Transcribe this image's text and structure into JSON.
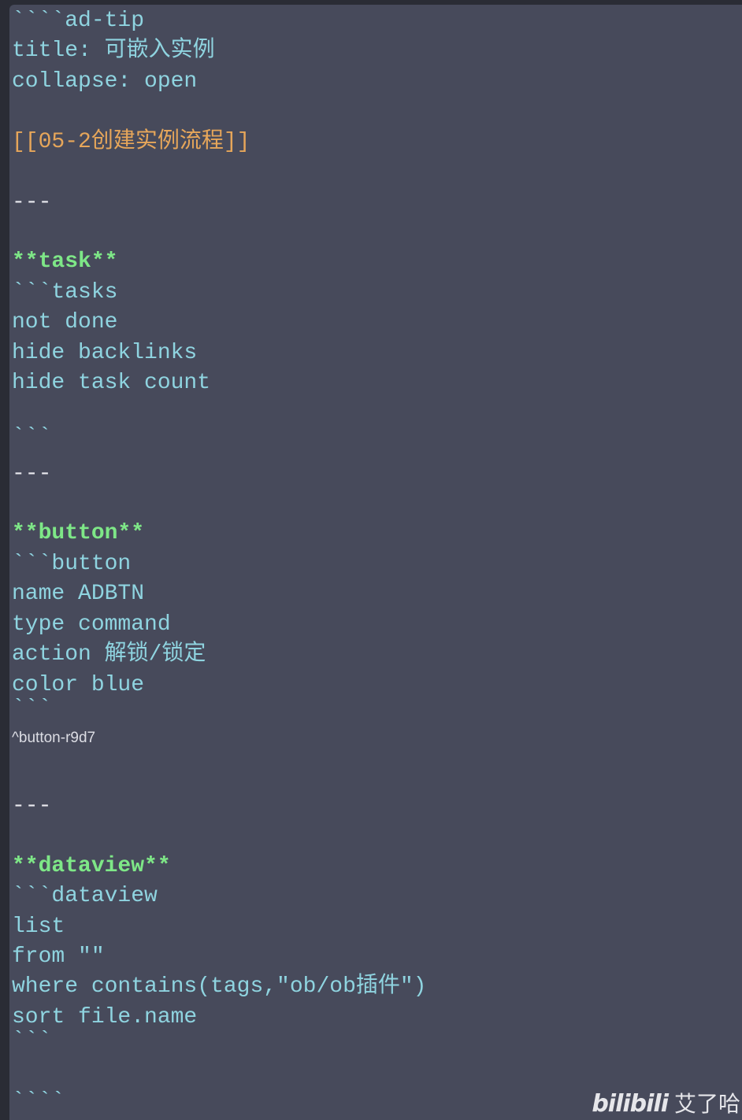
{
  "lines": [
    "````ad-tip",
    "title: 可嵌入实例",
    "collapse: open",
    "[[05-2创建实例流程]]",
    "---",
    "**task**",
    "```tasks",
    "not done",
    "hide backlinks",
    "hide task count",
    "```",
    "---",
    "**button**",
    "```button",
    "name ADBTN",
    "type command",
    "action 解锁/锁定",
    "color blue",
    "```",
    "^button-r9d7",
    "---",
    "**dataview**",
    "```dataview",
    "list",
    "from \"\"",
    "where contains(tags,\"ob/ob插件\")",
    "sort file.name",
    "```",
    "````"
  ],
  "watermark": {
    "logo": "bilibili",
    "author": "艾了哈"
  },
  "colors": {
    "background": "#474a5b",
    "code": "#8fd4e0",
    "link": "#e6a65a",
    "bold": "#7ee787"
  }
}
